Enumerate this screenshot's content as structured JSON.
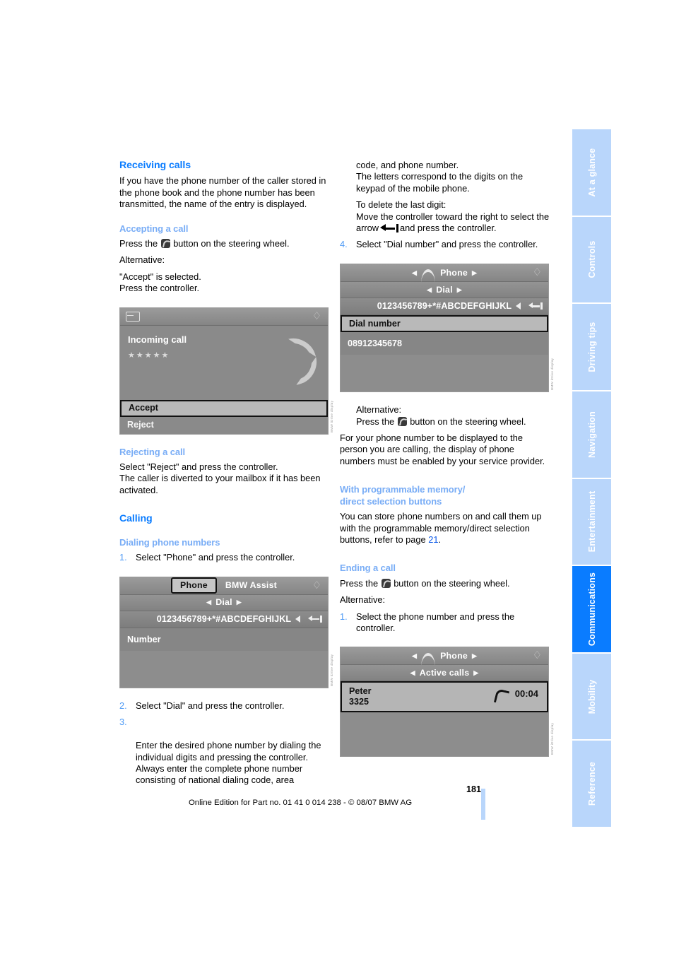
{
  "sidebar": {
    "tabs": [
      {
        "label": "At a glance",
        "active": false
      },
      {
        "label": "Controls",
        "active": false
      },
      {
        "label": "Driving tips",
        "active": false
      },
      {
        "label": "Navigation",
        "active": false
      },
      {
        "label": "Entertainment",
        "active": false
      },
      {
        "label": "Communications",
        "active": true
      },
      {
        "label": "Mobility",
        "active": false
      },
      {
        "label": "Reference",
        "active": false
      }
    ],
    "active_color": "#0a7cff",
    "inactive_color": "#b9d6fb"
  },
  "colors": {
    "heading_primary": "#0a7cff",
    "heading_secondary": "#79adf6",
    "link": "#0a58e8",
    "body_text": "#000000"
  },
  "left_column": {
    "heading_receiving": "Receiving calls",
    "receiving_body": "If you have the phone number of the caller stored in the phone book and the phone number has been transmitted, the name of the entry is displayed.",
    "heading_accepting": "Accepting a call",
    "accepting_press_pre": "Press the",
    "accepting_press_post": "button on the steering wheel.",
    "alternative_label": "Alternative:",
    "accept_selected": "\"Accept\" is selected.",
    "press_controller": "Press the controller.",
    "heading_rejecting": "Rejecting a call",
    "rejecting_body_1": "Select \"Reject\" and press the controller.",
    "rejecting_body_2": "The caller is diverted to your mailbox if it has been activated.",
    "heading_calling": "Calling",
    "heading_dialing": "Dialing phone numbers",
    "steps": [
      {
        "num": "1.",
        "text": "Select \"Phone\" and press the controller."
      },
      {
        "num": "2.",
        "text": "Select \"Dial\" and press the controller."
      },
      {
        "num": "3.",
        "text": "Enter the desired phone number by dialing the individual digits and pressing the controller.\nAlways enter the complete phone number consisting of national dialing code, area"
      }
    ]
  },
  "right_column": {
    "continued_1": "code, and phone number.",
    "continued_2": "The letters correspond to the digits on the keypad of the mobile phone.",
    "delete_label": "To delete the last digit:",
    "delete_pre": "Move the controller toward the right to select the arrow",
    "delete_post": "and press the controller.",
    "step4_num": "4.",
    "step4_text": "Select \"Dial number\" and press the controller.",
    "alternative_label": "Alternative:",
    "alt_press_pre": "Press the",
    "alt_press_post": "button on the steering wheel.",
    "service_provider_note": "For your phone number to be displayed to the person you are calling, the display of phone numbers must be enabled by your service provider.",
    "heading_programmable_line1": "With programmable memory/",
    "heading_programmable_line2": "direct selection buttons",
    "programmable_body_pre": "You can store phone numbers on and call them up with the programmable memory/direct selection buttons, refer to page",
    "programmable_page_ref": "21",
    "programmable_body_post": ".",
    "heading_ending": "Ending a call",
    "ending_press_pre": "Press the",
    "ending_press_post": "button on the steering wheel.",
    "ending_step_num": "1.",
    "ending_step_text": "Select the phone number and press the controller."
  },
  "screenshots": {
    "incoming_call": {
      "title": "Incoming call",
      "stars": "★★★★★",
      "accept_label": "Accept",
      "reject_label": "Reject",
      "corner_icon": "display-settings-icon",
      "left_icon": "phone-list-icon",
      "watermark": "BMW iDrive display"
    },
    "dial_phone": {
      "tab_selected": "Phone",
      "tab_other": "BMW Assist",
      "menu_label": "Dial",
      "keyboard": "0123456789+*#ABCDEFGHIJKL",
      "field_label": "Number",
      "watermark": "BMW iDrive display"
    },
    "dial_number": {
      "header": "Phone",
      "menu_label": "Dial",
      "keyboard": "0123456789+*#ABCDEFGHIJKL",
      "selected_item": "Dial number",
      "entered_number": "08912345678",
      "watermark": "BMW iDrive display"
    },
    "active_calls": {
      "header": "Phone",
      "menu_label": "Active calls",
      "caller_name": "Peter",
      "caller_number": "3325",
      "duration": "00:04",
      "watermark": "BMW iDrive display"
    }
  },
  "footer": {
    "page_number": "181",
    "imprint": "Online Edition for Part no. 01 41 0 014 238 - © 08/07 BMW AG"
  }
}
